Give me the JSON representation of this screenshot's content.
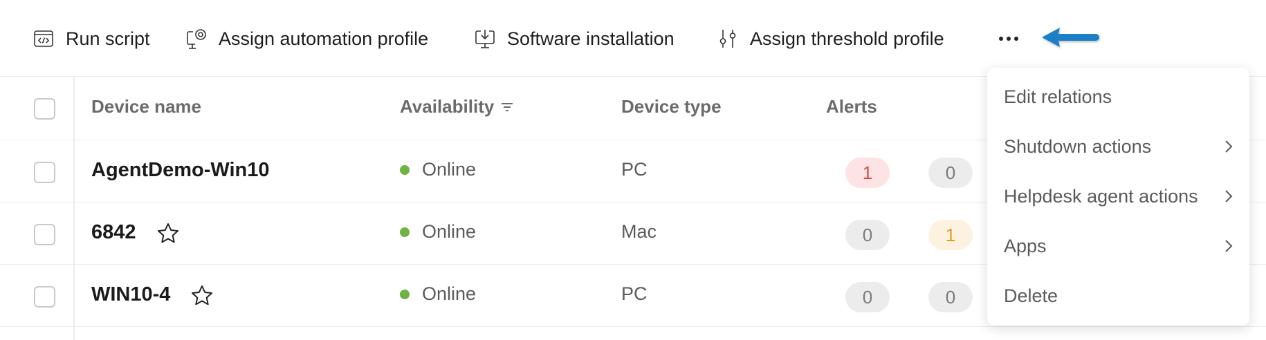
{
  "toolbar": {
    "run_script": "Run script",
    "assign_automation": "Assign automation profile",
    "software_installation": "Software installation",
    "assign_threshold": "Assign threshold profile"
  },
  "table": {
    "headers": {
      "device_name": "Device name",
      "availability": "Availability",
      "device_type": "Device type",
      "alerts": "Alerts"
    },
    "rows": [
      {
        "name": "AgentDemo-Win10",
        "starred": false,
        "availability": "Online",
        "type": "PC",
        "alert_a": "1",
        "alert_b": "0"
      },
      {
        "name": "6842",
        "starred": true,
        "availability": "Online",
        "type": "Mac",
        "alert_a": "0",
        "alert_b": "1"
      },
      {
        "name": "WIN10-4",
        "starred": true,
        "availability": "Online",
        "type": "PC",
        "alert_a": "0",
        "alert_b": "0"
      }
    ]
  },
  "menu": {
    "items": [
      "Edit relations",
      "Shutdown actions",
      "Helpdesk agent actions",
      "Apps",
      "Delete"
    ]
  },
  "colors": {
    "online": "#6fb342",
    "alert_red": "#d94848",
    "alert_orange": "#e59a22",
    "arrow": "#1a7fc6"
  }
}
